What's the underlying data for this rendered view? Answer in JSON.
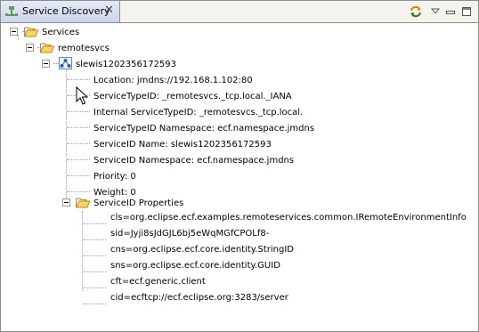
{
  "tab": {
    "title": "Service Discovery",
    "icon": "network-icon",
    "close_glyph": "✕"
  },
  "toolbar": {
    "icons": [
      "sync-icon",
      "view-menu-icon",
      "minimize-icon",
      "maximize-icon"
    ]
  },
  "tree": {
    "root": "Services",
    "group": "remotesvcs",
    "service": "slewis1202356172593",
    "details": [
      "Location: jmdns://192.168.1.102:80",
      "ServiceTypeID: _remotesvcs._tcp.local._IANA",
      "Internal ServiceTypeID: _remotesvcs._tcp.local.",
      "ServiceTypeID Namespace: ecf.namespace.jmdns",
      "ServiceID Name: slewis1202356172593",
      "ServiceID Namespace: ecf.namespace.jmdns",
      "Priority: 0",
      "Weight: 0"
    ],
    "properties_label": "ServiceID Properties",
    "properties": [
      "cls=org.eclipse.ecf.examples.remoteservices.common.IRemoteEnvironmentInfo",
      "sid=Jyji8sJdGJL6bj5eWqMGfCPOLf8-",
      "cns=org.eclipse.ecf.core.identity.StringID",
      "sns=org.eclipse.ecf.core.identity.GUID",
      "cft=ecf.generic.client",
      "cid=ecftcp://ecf.eclipse.org:3283/server"
    ]
  }
}
